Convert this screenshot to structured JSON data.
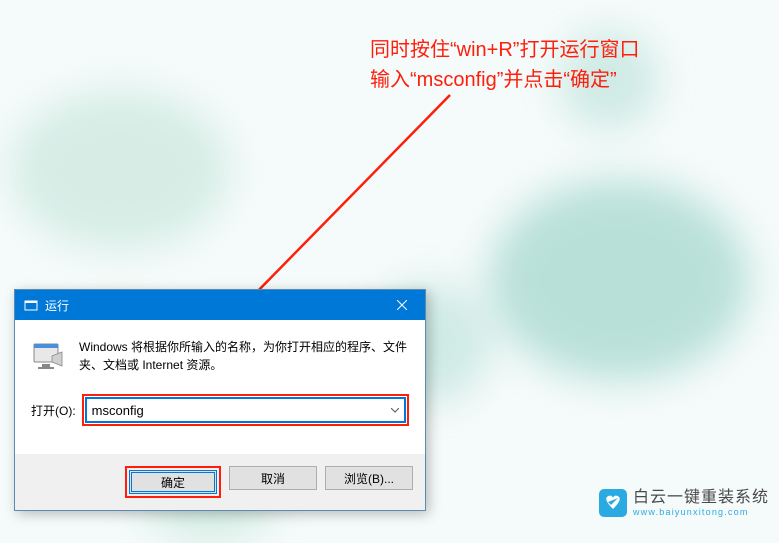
{
  "annotation": {
    "line1": "同时按住“win+R”打开运行窗口",
    "line2": "输入“msconfig”并点击“确定”"
  },
  "dialog": {
    "title": "运行",
    "description": "Windows 将根据你所输入的名称，为你打开相应的程序、文件夹、文档或 Internet 资源。",
    "input_label": "打开(O):",
    "input_value": "msconfig",
    "buttons": {
      "ok": "确定",
      "cancel": "取消",
      "browse": "浏览(B)..."
    }
  },
  "watermark": {
    "brand": "白云一键重装系统",
    "url": "www.baiyunxitong.com"
  }
}
